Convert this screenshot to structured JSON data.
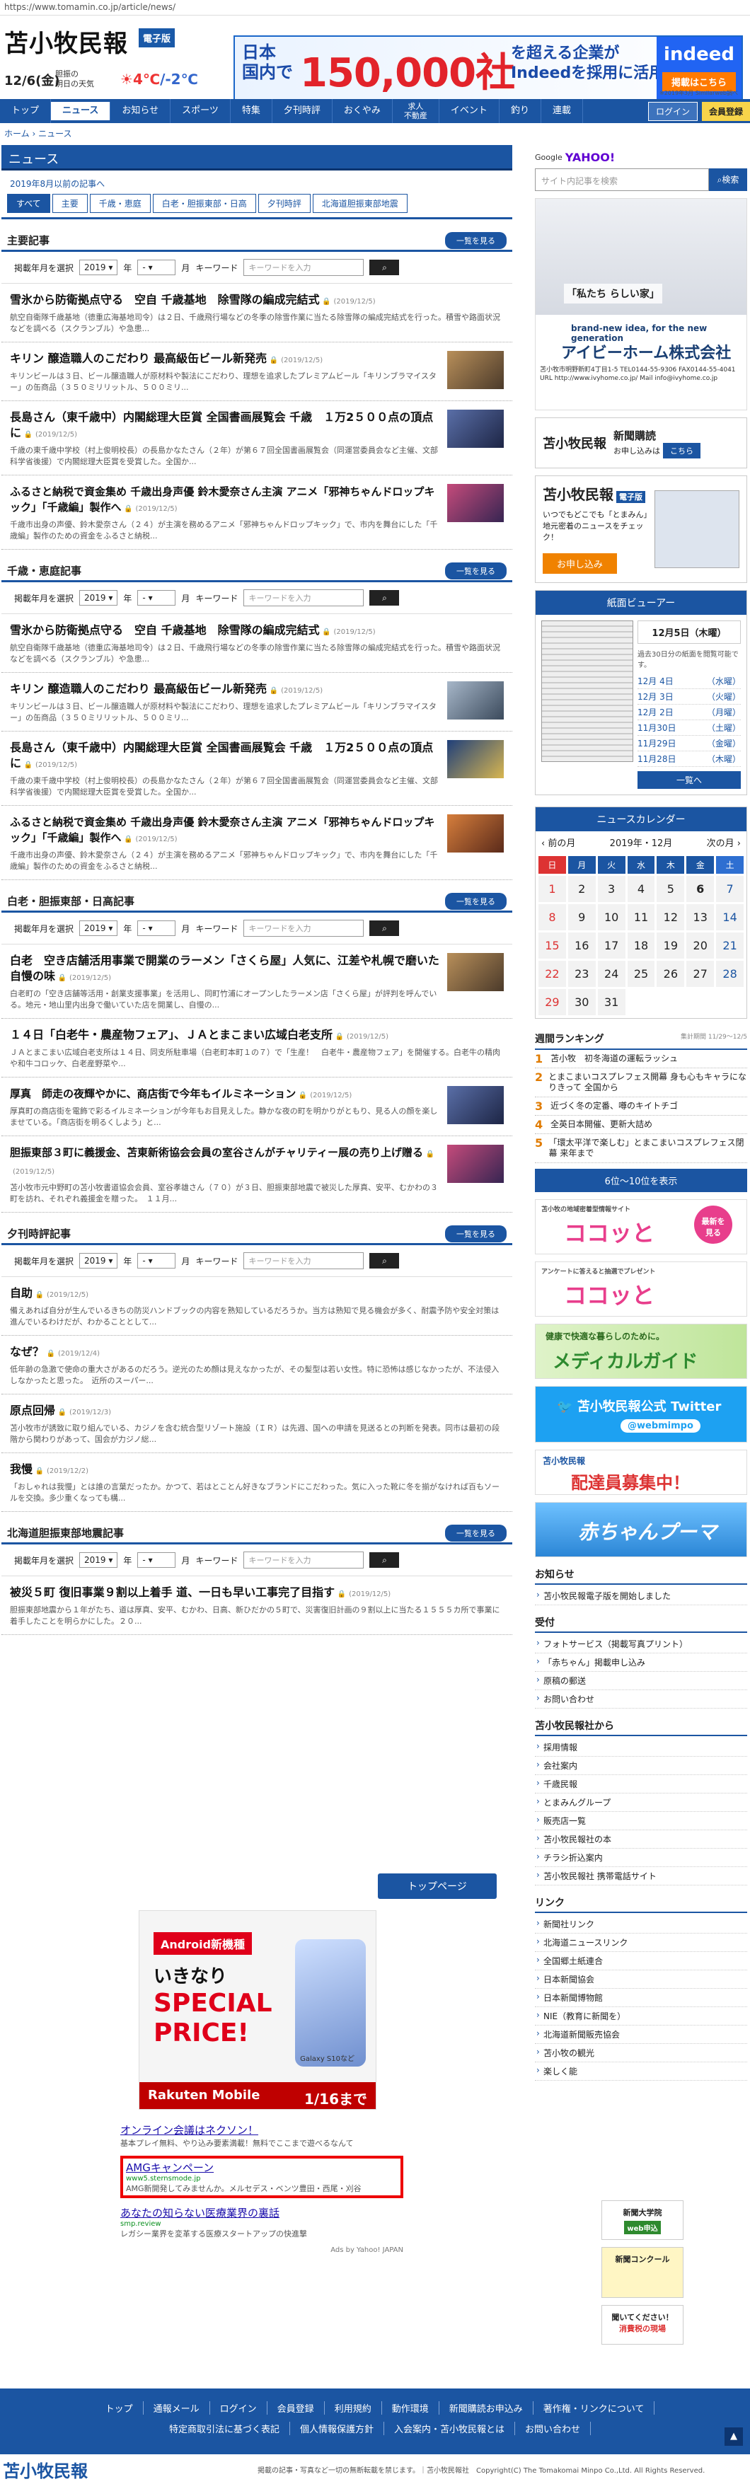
{
  "url": "https://www.tomamin.co.jp/article/news/",
  "header": {
    "logo": "苫小牧民報",
    "edition": "電子版",
    "date": "12/6(金)",
    "tomorrow_label": "胆振の\n明日の天気",
    "temp_high": "4℃",
    "temp_low": "/-2℃"
  },
  "top_ad": {
    "line1": "日本\n国内で",
    "big": "150,000社",
    "line2": "を超える企業が\nIndeedを採用に活用",
    "brand": "indeed",
    "cta": "掲載はこちら",
    "note": "※2019年3月 Similarweb調べ"
  },
  "nav": {
    "items": [
      "トップ",
      "ニュース",
      "お知らせ",
      "スポーツ",
      "特集",
      "夕刊時評",
      "おくやみ",
      "求人\n不動産",
      "イベント",
      "釣り",
      "連載"
    ],
    "login": "ログイン",
    "register": "会員登録"
  },
  "breadcrumb": "ホーム › ニュース",
  "news": {
    "title": "ニュース",
    "sub": "2019年8月以前の記事へ",
    "tabs": [
      "すべて",
      "主要",
      "千歳・恵庭",
      "白老・胆振東部・日高",
      "夕刊時評",
      "北海道胆振東部地震"
    ]
  },
  "filter": {
    "label": "掲載年月を選択",
    "year": "2019",
    "year_unit": "年",
    "month": "-",
    "month_unit": "月",
    "kw_label": "キーワード",
    "kw_placeholder": "キーワードを入力"
  },
  "list_button": "一覧を見る",
  "sections": [
    {
      "title": "主要記事",
      "articles": [
        {
          "title": "雪氷から防衛拠点守る　空自 千歳基地　除雪隊の編成完結式",
          "date": "(2019/12/5)",
          "lead": "航空自衛隊千歳基地（德重広海基地司令）は２日、千歳飛行場などの冬季の除雪作業に当たる除雪隊の編成完結式を行った。積雪や路面状況などを調べる（スクランブル）や急患...",
          "thumb": false
        },
        {
          "title": "キリン 醸造職人のこだわり 最高級缶ビール新発売",
          "date": "(2019/12/5)",
          "lead": "キリンビールは３日、ビール醸造職人が原材料や製法にこだわり、理想を追求したプレミアムビール「キリンブラマイスター」の缶商品（３５０ミリリットル、５００ミリ...",
          "thumb": true
        },
        {
          "title": "長島さん（東千歳中）内閣総理大臣賞 全国書画展覧会 千歳　１万2５００点の頂点に",
          "date": "(2019/12/5)",
          "lead": "千歳の東千歳中学校（村上俊明校長）の長島かなたさん（２年）が第６７回全国書画展覧会（同運営委員会など主催、文部科学省後援）で内閣総理大臣賞を受賞した。全国か...",
          "thumb": true
        },
        {
          "title": "ふるさと納税で資金集め 千歳出身声優 鈴木愛奈さん主演 アニメ「邪神ちゃんドロップキック」「千歳編」製作へ",
          "date": "(2019/12/5)",
          "lead": "千歳市出身の声優、鈴木愛奈さん（２４）が主演を務めるアニメ「邪神ちゃんドロップキック」で、市内を舞台にした「千歳編」製作のための資金をふるさと納税...",
          "thumb": true
        }
      ]
    },
    {
      "title": "千歳・恵庭記事",
      "articles": [
        {
          "title": "雪氷から防衛拠点守る　空自 千歳基地　除雪隊の編成完結式",
          "date": "(2019/12/5)",
          "lead": "航空自衛隊千歳基地（德重広海基地司令）は２日、千歳飛行場などの冬季の除雪作業に当たる除雪隊の編成完結式を行った。積雪や路面状況などを調べる（スクランブル）や急患...",
          "thumb": false
        },
        {
          "title": "キリン 醸造職人のこだわり 最高級缶ビール新発売",
          "date": "(2019/12/5)",
          "lead": "キリンビールは３日、ビール醸造職人が原材料や製法にこだわり、理想を追求したプレミアムビール「キリンブラマイスター」の缶商品（３５０ミリリットル、５００ミリ...",
          "thumb": true
        },
        {
          "title": "長島さん（東千歳中）内閣総理大臣賞 全国書画展覧会 千歳　１万2５００点の頂点に",
          "date": "(2019/12/5)",
          "lead": "千歳の東千歳中学校（村上俊明校長）の長島かなたさん（２年）が第６７回全国書画展覧会（同運営委員会など主催、文部科学省後援）で内閣総理大臣賞を受賞した。全国か...",
          "thumb": true
        },
        {
          "title": "ふるさと納税で資金集め 千歳出身声優 鈴木愛奈さん主演 アニメ「邪神ちゃんドロップキック」「千歳編」製作へ",
          "date": "(2019/12/5)",
          "lead": "千歳市出身の声優、鈴木愛奈さん（２４）が主演を務めるアニメ「邪神ちゃんドロップキック」で、市内を舞台にした「千歳編」製作のための資金をふるさと納税...",
          "thumb": true
        }
      ]
    },
    {
      "title": "白老・胆振東部・日高記事",
      "articles": [
        {
          "title": "白老　空き店舗活用事業で開業のラーメン「さくら屋」人気に、江差や札幌で磨いた自慢の味",
          "date": "(2019/12/5)",
          "lead": "白老町の「空き店舗等活用・創業支援事業」を活用し、同町竹浦にオープンしたラーメン店「さくら屋」が評判を呼んでいる。地元・地山里内出身で働いていた店を開業し、自慢の...",
          "thumb": true
        },
        {
          "title": "１４日「白老牛・農産物フェア」、ＪＡとまこまい広域白老支所",
          "date": "(2019/12/5)",
          "lead": "ＪＡとまこまい広域白老支所は１４日、同支所駐車場（白老町本町１の７）で「生産！　白老牛・農産物フェア」を開催する。白老牛の精肉や和牛コロッケ、白老産野菜や...",
          "thumb": false
        },
        {
          "title": "厚真　師走の夜輝やかに、商店街で今年もイルミネーション",
          "date": "(2019/12/5)",
          "lead": "厚真町の商店街を電飾で彩るイルミネーションが今年もお目見えした。静かな夜の町を明かりがともり、見る人の顔を楽しませている。「商店街を明るくしよう」と...",
          "thumb": true
        },
        {
          "title": "胆振東部３町に義援金、苫東新術協会会員の室谷さんがチャリティー展の売り上げ贈る",
          "date": "(2019/12/5)",
          "lead": "苫小牧市元中野町の苫小牧書道協会会員、室谷孝雄さん（７０）が３日、胆振東部地震で被災した厚真、安平、むかわの３町を訪れ、それぞれ義援金を贈った。　１１月...",
          "thumb": true
        }
      ]
    },
    {
      "title": "夕刊時評記事",
      "articles": [
        {
          "title": "自助",
          "date": "(2019/12/5)",
          "lead": "備えあれば自分が生んでいるきちの防災ハンドブックの内容を熟知しているだろうか。当方は熟知で見る機会が多く、耐震予防や安全対策は進んでいるわけだが、わかることとして...",
          "thumb": false
        },
        {
          "title": "なぜ？",
          "date": "(2019/12/4)",
          "lead": "低年齢の急激で使命の重大さがあるのだろう。逆光のため顔は見えなかったが、その髪型は若い女性。特に恐怖は感じなかったが、不法侵入しなかったと思った。　近所のスーパー...",
          "thumb": false
        },
        {
          "title": "原点回帰",
          "date": "(2019/12/3)",
          "lead": "苫小牧市が誘致に取り組んでいる、カジノを含む統合型リゾート施設（ＩＲ）は先週、国への申請を見送るとの判断を発表。同市は最初の段階から関わりがあって、国会が力ジノ総...",
          "thumb": false
        },
        {
          "title": "我慢",
          "date": "(2019/12/2)",
          "lead": "「おしゃれは我慢」とは誰の言葉だったか。かつて、若はとことん好きなブランドにこだわった。気に入った靴に冬を揃がなければ百もソールを交換。多少重くなっても構...",
          "thumb": false
        }
      ]
    },
    {
      "title": "北海道胆振東部地震記事",
      "articles": [
        {
          "title": "被災５町 復旧事業９割以上着手 道、一日も早い工事完了目指す",
          "date": "(2019/12/5)",
          "lead": "胆振東部地震から１年がたち、道は厚真、安平、むかわ、日高、新ひだかの５町で、災害復旧計画の９割以上に当たる１５５５カ所で事業に着手したことを明らかにした。２０...",
          "thumb": false
        }
      ]
    }
  ],
  "top_page_button": "トップページ",
  "rakuten_ad": {
    "tag": "Android新機種",
    "text1": "いきなり",
    "text2": "SPECIAL\nPRICE!",
    "phone": "Galaxy S10など",
    "brand": "Rakuten Mobile",
    "date": "1/16まで"
  },
  "yahoo_ads": [
    {
      "title": "オンライン会議はネクソン！",
      "url": "",
      "desc": "基本プレイ無料、やり込み要素満載！無料でここまで遊べるなんて"
    },
    {
      "title": "AMGキャンペーン",
      "url": "www5.sternsmode.jp",
      "desc": "AMG新開発してみませんか。メルセデス・ベンツ豊田・西尾・刈谷"
    },
    {
      "title": "あなたの知らない医療業界の裏話",
      "url": "smp.review",
      "desc": "レガシー業界を変革する医療スタートアップの快進撃"
    }
  ],
  "yahoo_by": "Ads by Yahoo! JAPAN",
  "sidebar": {
    "google_label": "Google",
    "yahoo_label": "YAHOO!",
    "search_placeholder": "サイト内記事を検索",
    "search_button": "検索",
    "house_ad": {
      "c1": "「私たち らしい家」",
      "c2": "brand-new idea, for the new generation",
      "c3": "アイビーホーム株式会社",
      "c4": "苫小牧市明野新町4丁目1-5 TEL0144-55-9306 FAX0144-55-4041\nURL http://www.ivyhome.co.jp/  Mail info@ivyhome.co.jp"
    },
    "subscribe": {
      "logo": "苫小牧民報",
      "title": "新聞購読",
      "sub": "お申し込みは",
      "btn": "こちら"
    },
    "denshi": {
      "logo": "苫小牧民報",
      "tag": "電子版",
      "text": "いつでもどこでも「とまみん」地元密着のニュースをチェック！",
      "btn": "お申し込み"
    },
    "viewer": {
      "title": "紙面ビューアー",
      "date": "12月5日（木曜）",
      "note": "過去30日分の紙面を閲覧可能です。",
      "list": [
        [
          "12月 4日",
          "（水曜）"
        ],
        [
          "12月 3日",
          "（火曜）"
        ],
        [
          "12月 2日",
          "（月曜）"
        ],
        [
          "11月30日",
          "（土曜）"
        ],
        [
          "11月29日",
          "（金曜）"
        ],
        [
          "11月28日",
          "（木曜）"
        ]
      ],
      "more": "一覧へ"
    },
    "calendar": {
      "title": "ニュースカレンダー",
      "prev": "‹ 前の月",
      "month": "2019年・12月",
      "next": "次の月 ›",
      "heads": [
        "日",
        "月",
        "火",
        "水",
        "木",
        "金",
        "土"
      ],
      "weeks": [
        [
          "1",
          "2",
          "3",
          "4",
          "5",
          "6",
          "7"
        ],
        [
          "8",
          "9",
          "10",
          "11",
          "12",
          "13",
          "14"
        ],
        [
          "15",
          "16",
          "17",
          "18",
          "19",
          "20",
          "21"
        ],
        [
          "22",
          "23",
          "24",
          "25",
          "26",
          "27",
          "28"
        ],
        [
          "29",
          "30",
          "31",
          "",
          "",
          "",
          ""
        ]
      ]
    },
    "ranking": {
      "title": "週間ランキング",
      "period": "集計期間 11/29〜12/5",
      "items": [
        "苫小牧　初冬海道の運転ラッシュ",
        "とまこまいコスプレフェス開幕 身も心もキャラになりきって 全国から",
        "近づく冬の定番、噂のキイトチゴ",
        "全英日本開催、更新大詰め",
        "「環太平洋で楽しむ」とまこまいコスプレフェス閉幕 来年まで"
      ],
      "more": "6位〜10位を表示"
    },
    "b1": {
      "t": "苫小牧の地域密着型情報サイト",
      "k": "ココッと"
    },
    "b2": {
      "t": "アンケートに答えると抽選でプレゼント",
      "k": "ココッと"
    },
    "b3": {
      "t": "健康で快適な暮らしのために。",
      "k": "メディカルガイド"
    },
    "b4": {
      "k": "苫小牧民報公式 Twitter",
      "t": "@webmimpo"
    },
    "b5": {
      "t": "苫小牧民報",
      "k": "配達員募集中！"
    },
    "b6": {
      "k": "赤ちゃんプーマ"
    },
    "lists": [
      {
        "title": "お知らせ",
        "items": [
          "苫小牧民報電子版を開始しました"
        ]
      },
      {
        "title": "受付",
        "items": [
          "フォトサービス（掲載写真プリント）",
          "「赤ちゃん」掲載申し込み",
          "原稿の郵送",
          "お問い合わせ"
        ]
      },
      {
        "title": "苫小牧民報社から",
        "items": [
          "採用情報",
          "会社案内",
          "千歳民報",
          "とまみんグループ",
          "販売店一覧",
          "苫小牧民報社の本",
          "チラシ折込案内",
          "苫小牧民報社 携帯電話サイト"
        ]
      },
      {
        "title": "リンク",
        "items": [
          "新聞社リンク",
          "北海道ニュースリンク",
          "全国郷土紙連合",
          "日本新聞協会",
          "日本新聞博物館",
          "NIE（教育に新聞を）",
          "北海道新聞販売協会",
          "苫小牧の観光",
          "楽しく能"
        ]
      }
    ]
  },
  "footer_ads": [
    {
      "t": "新聞大学院",
      "tag": "web申込"
    },
    {
      "t": "新聞コンクール"
    },
    {
      "t": "聞いてください！",
      "s": "消費税の現場"
    }
  ],
  "footer": {
    "row1": [
      "トップ",
      "通報メール",
      "ログイン",
      "会員登録",
      "利用規約",
      "動作環境",
      "新聞購読お申込み",
      "著作権・リンクについて"
    ],
    "row2": [
      "特定商取引法に基づく表記",
      "個人情報保護方針",
      "入会案内・苫小牧民報とは",
      "お問い合わせ"
    ],
    "logo": "苫小牧民報",
    "copy": "掲載の記事・写真など一切の無断転載を禁じます。｜苫小牧民報社　Copyright(C) The Tomakomai Minpo Co.,Ltd. All Rights Reserved."
  }
}
